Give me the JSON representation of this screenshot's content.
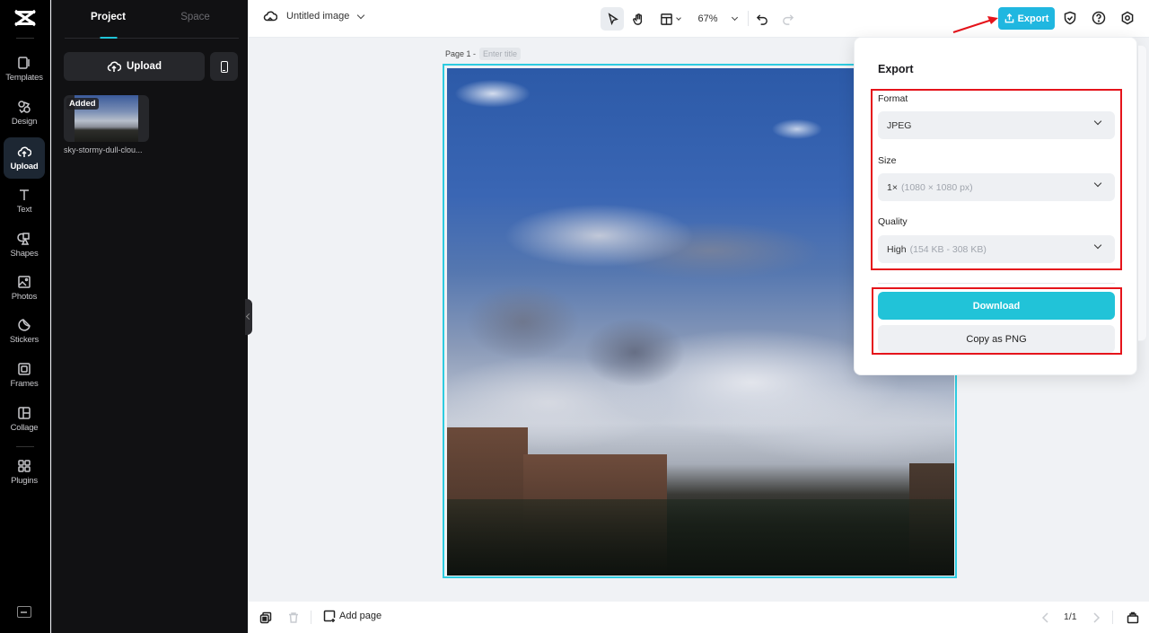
{
  "rail": {
    "items": [
      {
        "label": "Templates",
        "icon": "templates-icon"
      },
      {
        "label": "Design",
        "icon": "design-icon"
      },
      {
        "label": "Upload",
        "icon": "upload-cloud-icon",
        "active": true
      },
      {
        "label": "Text",
        "icon": "text-icon"
      },
      {
        "label": "Shapes",
        "icon": "shapes-icon"
      },
      {
        "label": "Photos",
        "icon": "photos-icon"
      },
      {
        "label": "Stickers",
        "icon": "stickers-icon"
      },
      {
        "label": "Frames",
        "icon": "frames-icon"
      },
      {
        "label": "Collage",
        "icon": "collage-icon"
      },
      {
        "label": "Plugins",
        "icon": "plugins-icon"
      }
    ]
  },
  "panel": {
    "tabs": [
      {
        "label": "Project",
        "active": true
      },
      {
        "label": "Space",
        "active": false
      }
    ],
    "upload_label": "Upload",
    "assets": [
      {
        "badge": "Added",
        "name": "sky-stormy-dull-clou..."
      }
    ]
  },
  "topbar": {
    "doc_title": "Untitled image",
    "zoom": "67%",
    "export_label": "Export"
  },
  "canvas": {
    "page_label": "Page 1 -",
    "title_placeholder": "Enter title"
  },
  "export_panel": {
    "title": "Export",
    "format_label": "Format",
    "format_value": "JPEG",
    "size_label": "Size",
    "size_value": "1×",
    "size_detail": "(1080 × 1080 px)",
    "quality_label": "Quality",
    "quality_value": "High",
    "quality_detail": "(154 KB - 308 KB)",
    "download_label": "Download",
    "copy_label": "Copy as PNG"
  },
  "bottombar": {
    "add_page_label": "Add page",
    "pager": "1/1"
  },
  "colors": {
    "accent": "#20c4d7",
    "export_button": "#20b7e0",
    "annotation_red": "#e5141b"
  }
}
